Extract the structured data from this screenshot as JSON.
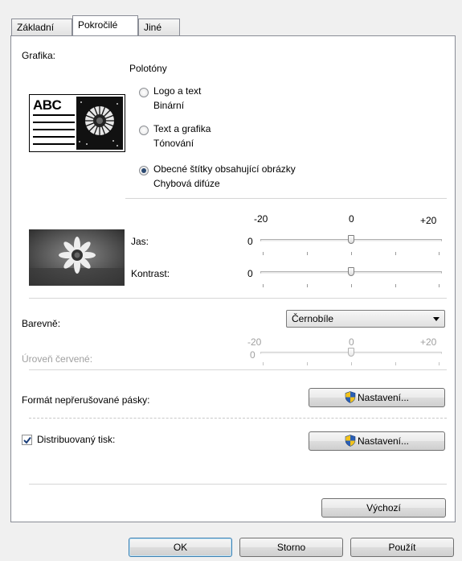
{
  "tabs": [
    {
      "label": "Základní"
    },
    {
      "label": "Pokročilé"
    },
    {
      "label": "Jiné"
    }
  ],
  "graphics": {
    "label": "Grafika:",
    "halftone_label": "Polotóny",
    "preview_text": "ABC",
    "options": [
      {
        "label": "Logo a text",
        "sublabel": "Binární",
        "checked": false
      },
      {
        "label": "Text a grafika",
        "sublabel": "Tónování",
        "checked": false
      },
      {
        "label": "Obecné štítky obsahující obrázky",
        "sublabel": "Chybová difúze",
        "checked": true
      }
    ]
  },
  "adjust": {
    "scale_min": "-20",
    "scale_mid": "0",
    "scale_max": "+20",
    "brightness": {
      "label": "Jas:",
      "value": "0"
    },
    "contrast": {
      "label": "Kontrast:",
      "value": "0"
    }
  },
  "color": {
    "label": "Barevně:",
    "selected": "Černobíle",
    "red_level": {
      "label": "Úroveň červené:",
      "value": "0",
      "scale_min": "-20",
      "scale_mid": "0",
      "scale_max": "+20"
    }
  },
  "continuous_tape": {
    "label": "Formát nepřerušované pásky:",
    "button": "Nastavení..."
  },
  "distributed": {
    "label": "Distribuovaný tisk:",
    "checked": true,
    "button": "Nastavení..."
  },
  "default_button": "Výchozí",
  "footer": {
    "ok": "OK",
    "cancel": "Storno",
    "apply": "Použít"
  },
  "colors": {
    "accent": "#3c7fb1",
    "radio_dot": "#2c4a72",
    "shield_blue": "#2b5fb4",
    "shield_yellow": "#f2c21b"
  }
}
